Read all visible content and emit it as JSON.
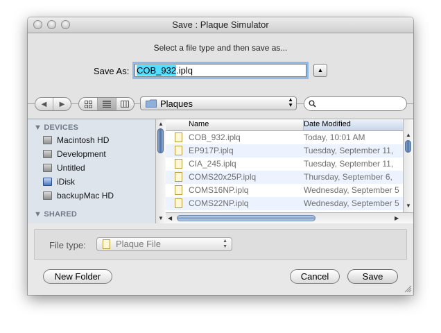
{
  "window": {
    "title": "Save : Plaque Simulator"
  },
  "save_panel": {
    "prompt": "Select a file type and then save as...",
    "save_as_label": "Save As:",
    "filename_selected": "COB_932",
    "filename_extension": ".iplq"
  },
  "toolbar": {
    "location": "Plaques",
    "search_value": ""
  },
  "sidebar": {
    "devices_header": "DEVICES",
    "devices": [
      "Macintosh HD",
      "Development",
      "Untitled",
      "iDisk",
      "backupMac HD"
    ],
    "shared_header": "SHARED"
  },
  "file_list": {
    "columns": {
      "name": "Name",
      "date": "Date Modified"
    },
    "rows": [
      {
        "name": "COB_932.iplq",
        "date": "Today, 10:01 AM"
      },
      {
        "name": "EP917P.iplq",
        "date": "Tuesday, September 11,"
      },
      {
        "name": "CIA_245.iplq",
        "date": "Tuesday, September 11,"
      },
      {
        "name": "COMS20x25P.iplq",
        "date": "Thursday, September 6,"
      },
      {
        "name": "COMS16NP.iplq",
        "date": "Wednesday, September 5"
      },
      {
        "name": "COMS22NP.iplq",
        "date": "Wednesday, September 5"
      }
    ]
  },
  "file_type": {
    "label": "File type:",
    "value": "Plaque File"
  },
  "buttons": {
    "new_folder": "New Folder",
    "cancel": "Cancel",
    "save": "Save"
  },
  "colors": {
    "selection": "#55ddff",
    "focus_ring": "#8fb8e8",
    "sidebar": "#dde4ec",
    "alt_row": "#edf3fe"
  }
}
